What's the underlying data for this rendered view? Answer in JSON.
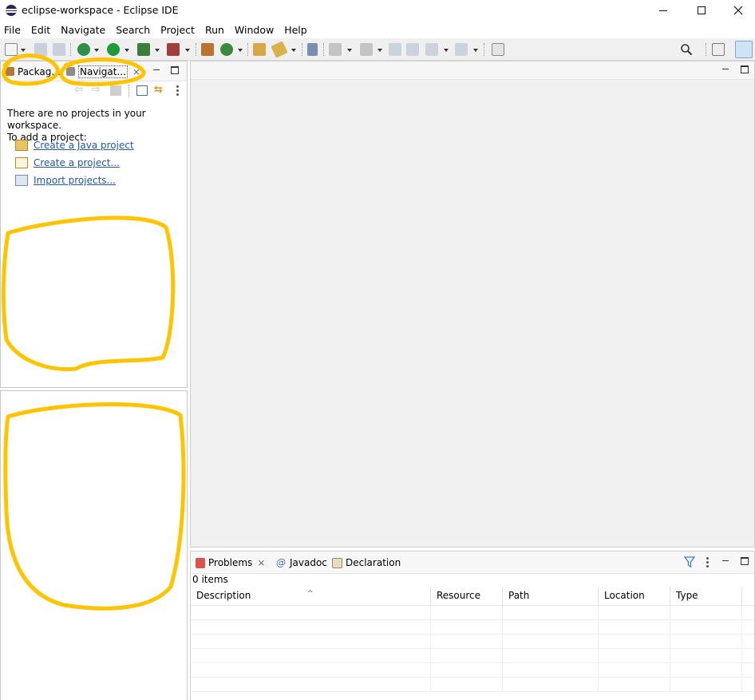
{
  "window": {
    "title": "eclipse-workspace - Eclipse IDE"
  },
  "menu": [
    "File",
    "Edit",
    "Navigate",
    "Search",
    "Project",
    "Run",
    "Window",
    "Help"
  ],
  "left_panel": {
    "tabs": [
      {
        "label": "Packag..."
      },
      {
        "label": "Navigat..."
      }
    ],
    "close_glyph": "⨯",
    "empty_message_line1": "There are no projects in your workspace.",
    "empty_message_line2": "To add a project:",
    "links": [
      {
        "label": "Create a Java project"
      },
      {
        "label": "Create a project..."
      },
      {
        "label": "Import projects..."
      }
    ]
  },
  "problems_panel": {
    "tabs": [
      {
        "label": "Problems"
      },
      {
        "label": "Javadoc"
      },
      {
        "label": "Declaration"
      }
    ],
    "close_glyph": "⨯",
    "item_count": "0 items",
    "columns": [
      "Description",
      "Resource",
      "Path",
      "Location",
      "Type"
    ]
  },
  "colors": {
    "annotation": "#ffc400",
    "link": "#2457a0"
  }
}
